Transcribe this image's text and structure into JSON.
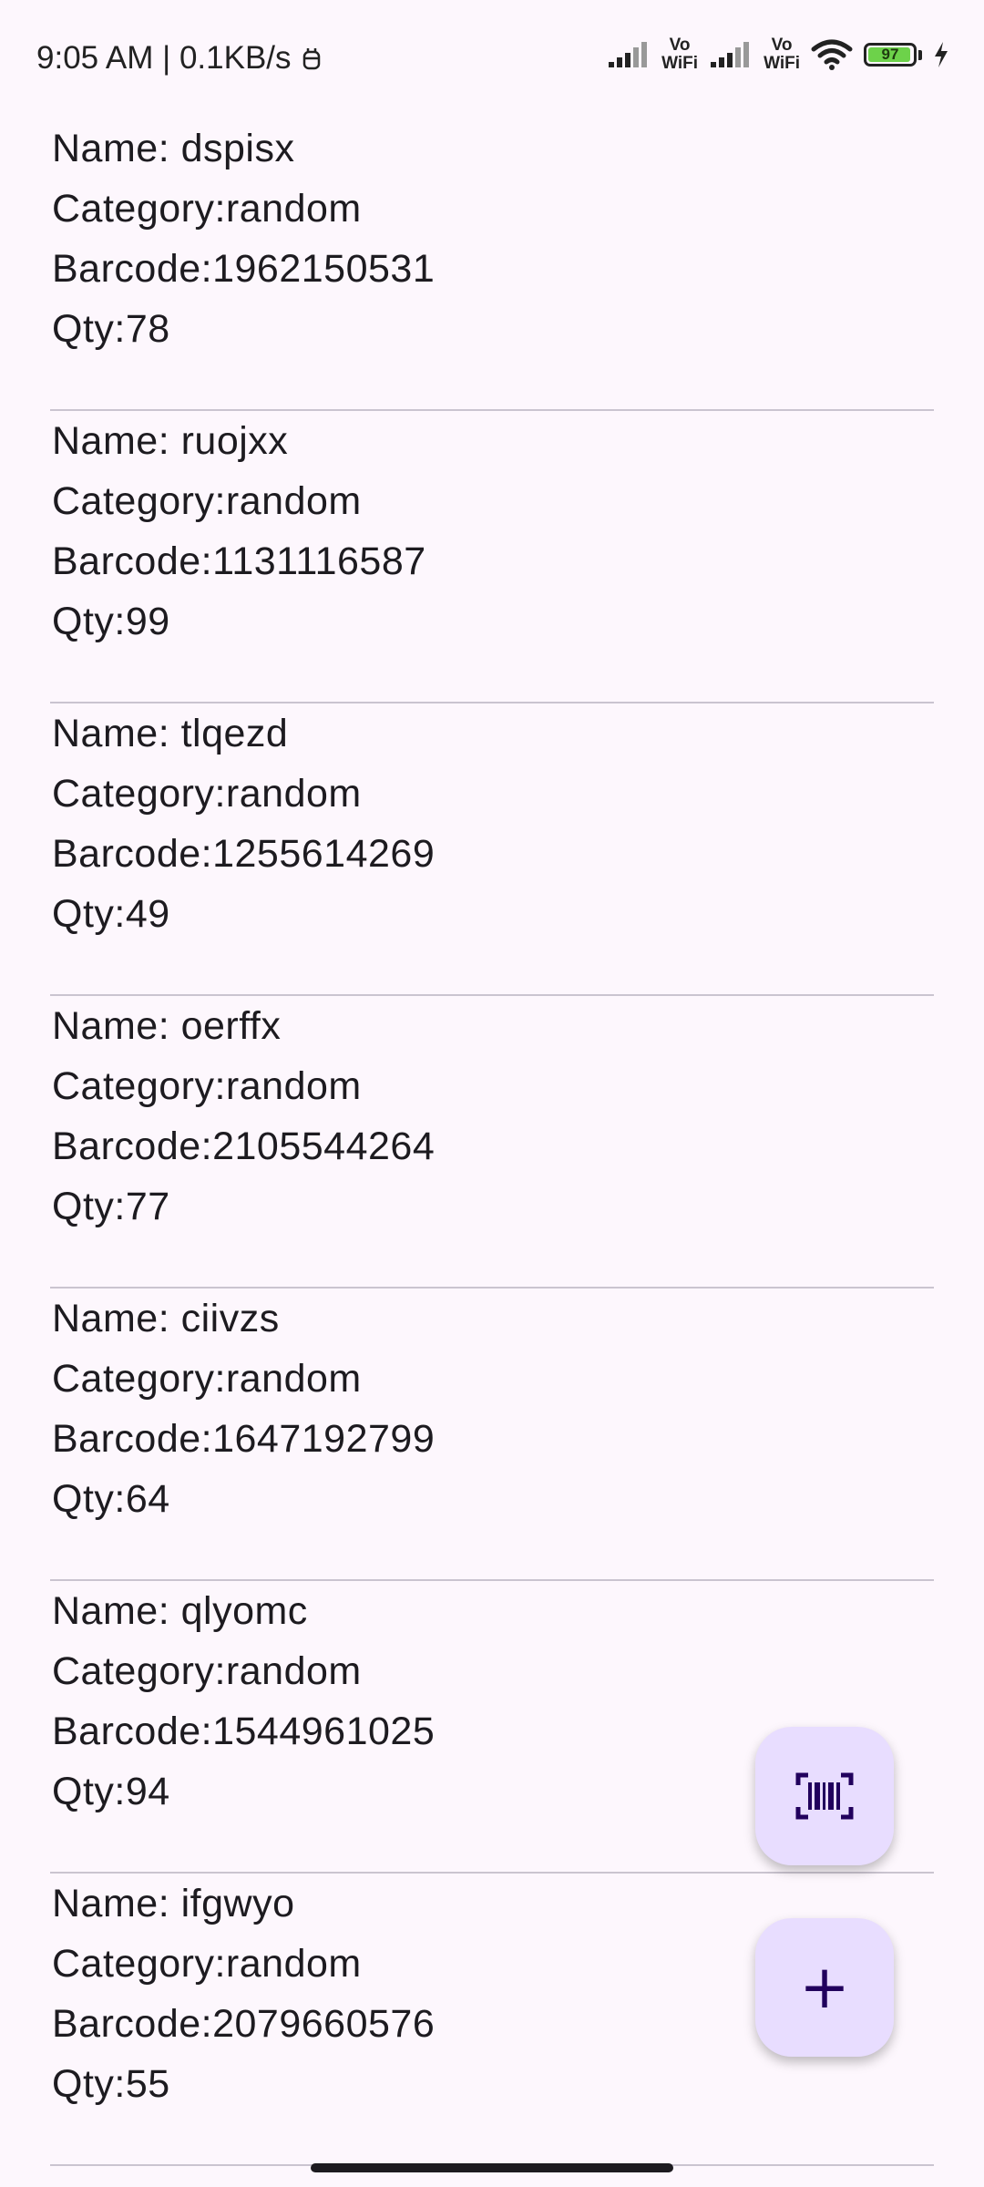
{
  "status_bar": {
    "time_speed": "9:05 AM | 0.1KB/s",
    "vowifi_1": "Vo\nWiFi",
    "vowifi_2": "Vo\nWiFi",
    "battery_level": "97"
  },
  "items": [
    {
      "name": "Name: dspisx",
      "category": "Category:random",
      "barcode": "Barcode:1962150531",
      "qty": "Qty:78"
    },
    {
      "name": "Name: ruojxx",
      "category": "Category:random",
      "barcode": "Barcode:1131116587",
      "qty": "Qty:99"
    },
    {
      "name": "Name: tlqezd",
      "category": "Category:random",
      "barcode": "Barcode:1255614269",
      "qty": "Qty:49"
    },
    {
      "name": "Name: oerffx",
      "category": "Category:random",
      "barcode": "Barcode:2105544264",
      "qty": "Qty:77"
    },
    {
      "name": "Name: ciivzs",
      "category": "Category:random",
      "barcode": "Barcode:1647192799",
      "qty": "Qty:64"
    },
    {
      "name": "Name: qlyomc",
      "category": "Category:random",
      "barcode": "Barcode:1544961025",
      "qty": "Qty:94"
    },
    {
      "name": "Name: ifgwyo",
      "category": "Category:random",
      "barcode": "Barcode:2079660576",
      "qty": "Qty:55"
    }
  ],
  "fabs": {
    "scan_icon": "barcode-scan-icon",
    "add_label": "+"
  },
  "colors": {
    "background": "#fdf7fd",
    "fab_background": "#e8ddff",
    "fab_icon": "#21005d",
    "divider": "#cac4d0"
  }
}
